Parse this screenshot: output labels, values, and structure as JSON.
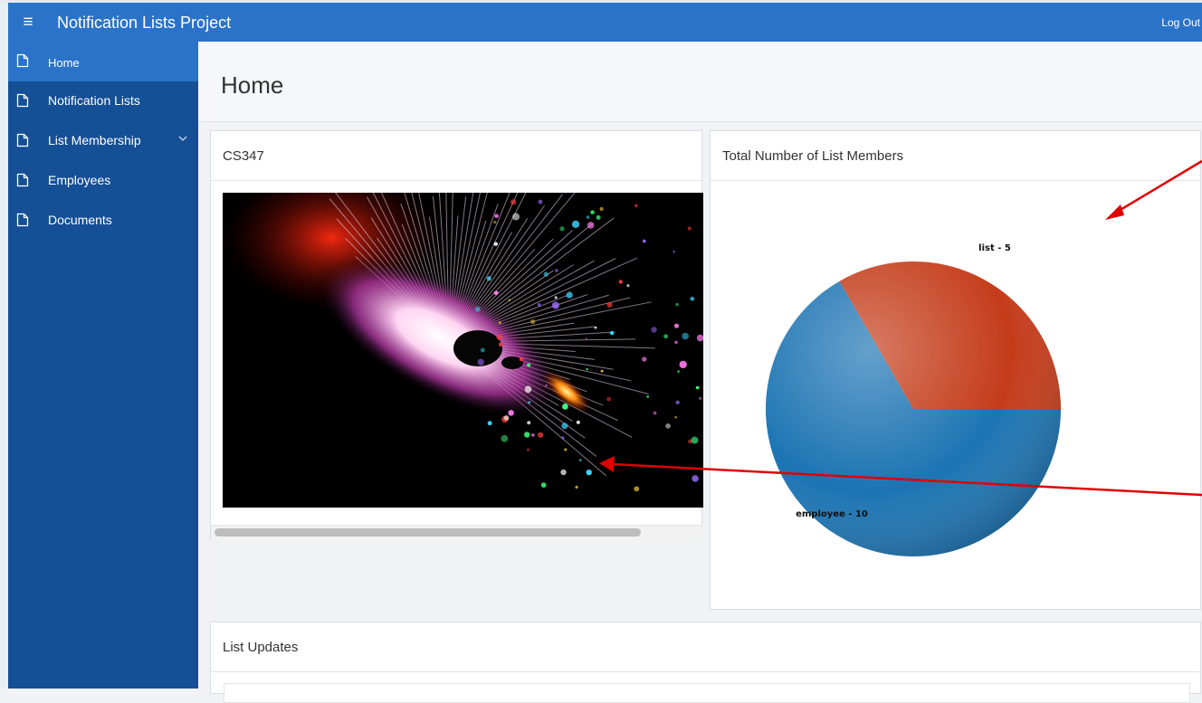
{
  "app": {
    "title": "Notification Lists Project",
    "logout_label": "Log Out",
    "accent": "#2a73c9",
    "sidebar_color": "#154f95"
  },
  "sidebar": {
    "items": [
      {
        "label": "Home",
        "icon": "page-icon",
        "active": true
      },
      {
        "label": "Notification Lists",
        "icon": "page-icon"
      },
      {
        "label": "List Membership",
        "icon": "page-icon",
        "expandable": true
      },
      {
        "label": "Employees",
        "icon": "page-icon"
      },
      {
        "label": "Documents",
        "icon": "page-icon"
      }
    ]
  },
  "page": {
    "title": "Home"
  },
  "cards": {
    "cs347": {
      "title": "CS347",
      "image": "abstract colorful particle burst"
    },
    "list_members": {
      "title": "Total Number of List Members"
    },
    "list_updates": {
      "title": "List Updates"
    }
  },
  "chart_data": {
    "type": "pie",
    "slices": [
      {
        "label": "list - 5",
        "value": 5,
        "color": "#c43c1a"
      },
      {
        "label": "employee - 10",
        "value": 10,
        "color": "#1c74b3"
      }
    ]
  },
  "annotation_arrows_color": "#e00000"
}
